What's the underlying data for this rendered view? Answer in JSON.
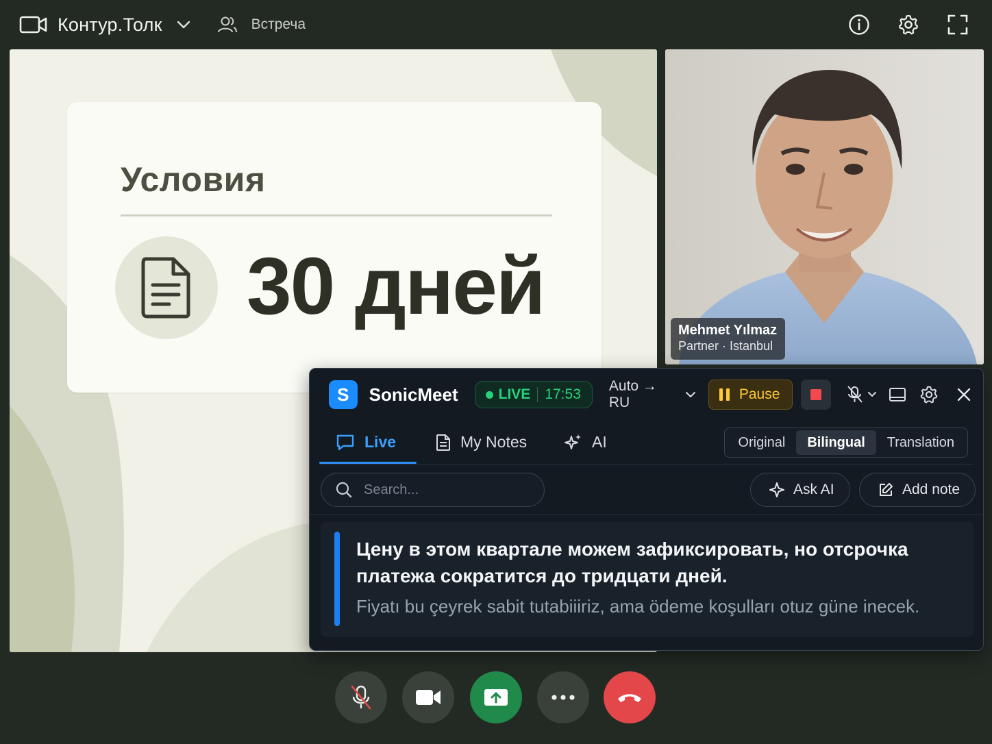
{
  "topbar": {
    "app_name": "Контур.Толк",
    "meeting_label": "Встреча",
    "icons": [
      "video-camera-icon",
      "chevron-down-icon",
      "users-icon",
      "info-icon",
      "gear-icon",
      "fullscreen-icon"
    ]
  },
  "slide": {
    "title": "Условия",
    "big_text": "30 дней",
    "icon": "document-icon"
  },
  "participant": {
    "name": "Mehmet Yılmaz",
    "role": "Partner · Istanbul"
  },
  "sonicmeet": {
    "logo_letter": "S",
    "brand": "SonicMeet",
    "status": "LIVE",
    "elapsed": "17:53",
    "language": "Auto → RU",
    "pause_label": "Pause",
    "tabs": [
      {
        "label": "Live",
        "active": true
      },
      {
        "label": "My Notes",
        "active": false
      },
      {
        "label": "AI",
        "active": false
      }
    ],
    "view_modes": [
      {
        "label": "Original",
        "selected": false
      },
      {
        "label": "Bilingual",
        "selected": true
      },
      {
        "label": "Translation",
        "selected": false
      }
    ],
    "search_placeholder": "Search...",
    "ask_ai_label": "Ask AI",
    "add_note_label": "Add note",
    "caption": {
      "translated": "Цену в этом квартале можем зафиксировать, но отсрочка платежа сократится до тридцати дней.",
      "original": "Fiyatı bu çeyrek sabit tutabiiiriz, ama ödeme koşulları otuz güne inecek."
    },
    "colors": {
      "accent": "#1a8cff",
      "live": "#28d27c",
      "pause": "#ffc93a",
      "stop": "#f2484f"
    }
  },
  "controls": {
    "buttons": [
      "mic-muted-icon",
      "video-icon",
      "share-screen-icon",
      "more-icon",
      "hang-up-icon"
    ]
  }
}
